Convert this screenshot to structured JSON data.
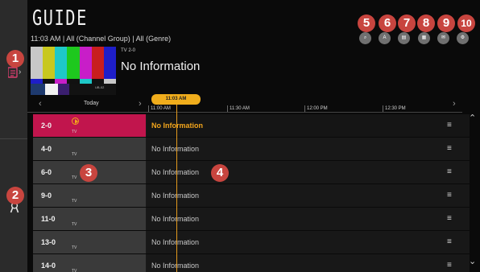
{
  "header": {
    "title": "GUIDE",
    "subtitle": "11:03 AM | All (Channel Group) | All (Genre)"
  },
  "preview": {
    "channel_number": "TV 2-0",
    "program": "No Information",
    "overlay_text": "UB-02"
  },
  "sidebar": {
    "items": [
      {
        "icon": "menu-list-icon"
      },
      {
        "icon": "record-icon"
      }
    ]
  },
  "badges": [
    "1",
    "2",
    "3",
    "4",
    "5",
    "6",
    "7",
    "8",
    "9",
    "10"
  ],
  "top_icons": [
    {
      "icon": "search-icon",
      "glyph": "⌕"
    },
    {
      "icon": "font-size-icon",
      "glyph": "A"
    },
    {
      "icon": "schedule-icon",
      "glyph": "▤"
    },
    {
      "icon": "recordings-icon",
      "glyph": "▦"
    },
    {
      "icon": "messages-icon",
      "glyph": "✉"
    },
    {
      "icon": "settings-icon",
      "glyph": "⚙"
    }
  ],
  "datebar": {
    "prev": "‹",
    "day": "Today",
    "next": "›",
    "later": "›",
    "times": [
      "11:00 AM",
      "11:30 AM",
      "12:00 PM",
      "12:30 PM"
    ],
    "now_time": "11:03 AM"
  },
  "channels": [
    {
      "number": "2-0",
      "type": "TV",
      "program": "No Information",
      "selected": true
    },
    {
      "number": "4-0",
      "type": "TV",
      "program": "No Information",
      "selected": false
    },
    {
      "number": "6-0",
      "type": "TV",
      "program": "No Information",
      "selected": false
    },
    {
      "number": "9-0",
      "type": "TV",
      "program": "No Information",
      "selected": false
    },
    {
      "number": "11-0",
      "type": "TV",
      "program": "No Information",
      "selected": false
    },
    {
      "number": "13-0",
      "type": "TV",
      "program": "No Information",
      "selected": false
    },
    {
      "number": "14-0",
      "type": "TV",
      "program": "No Information",
      "selected": false
    }
  ],
  "menu_glyph": "≡",
  "scroll": {
    "up": "⌃",
    "down": "⌄"
  },
  "colors": {
    "selected_row": "#c1154d",
    "accent": "#f2a51c",
    "badge": "#c8453f"
  }
}
